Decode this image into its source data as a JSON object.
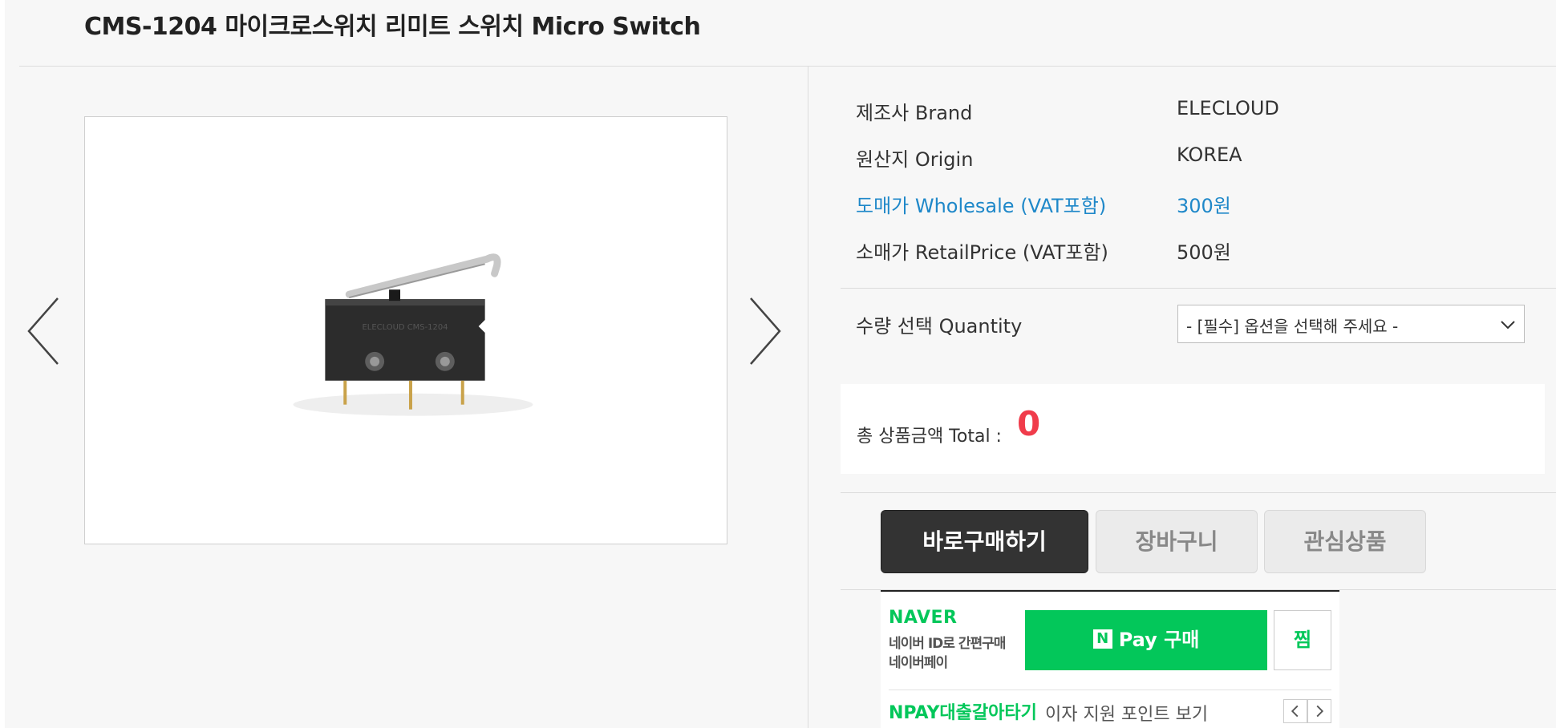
{
  "product": {
    "title": "CMS-1204 마이크로스위치 리미트 스위치 Micro Switch",
    "image_alt": "micro-switch-photo",
    "image_label_text": "ELECLOUD CMS-1204"
  },
  "info": {
    "brand_label": "제조사 Brand",
    "brand_value": "ELECLOUD",
    "origin_label": "원산지 Origin",
    "origin_value": "KOREA",
    "wholesale_label": "도매가 Wholesale (VAT포함)",
    "wholesale_value": "300원",
    "retail_label": "소매가 RetailPrice (VAT포함)",
    "retail_value": "500원"
  },
  "quantity": {
    "label": "수량 선택 Quantity",
    "selected_option": "- [필수] 옵션을 선택해 주세요 -"
  },
  "total": {
    "label": "총 상품금액 Total :",
    "value": "0"
  },
  "actions": {
    "buy_now": "바로구매하기",
    "cart": "장바구니",
    "wishlist": "관심상품"
  },
  "naver_pay": {
    "logo": "NAVER",
    "desc_line1": "네이버 ID로 간편구매",
    "desc_line2": "네이버페이",
    "n_mark": "N",
    "pay_button": "Pay 구매",
    "zzim": "찜",
    "promo_link": "NPAY대출갈아타기",
    "promo_text": "이자 지원 포인트 보기"
  },
  "colors": {
    "accent_blue": "#1f88c9",
    "total_red": "#f03c4b",
    "naver_green": "#03c75a",
    "buy_button": "#333333"
  },
  "icons": {
    "prev": "chevron-left-icon",
    "next": "chevron-right-icon",
    "select": "chevron-down-icon"
  }
}
